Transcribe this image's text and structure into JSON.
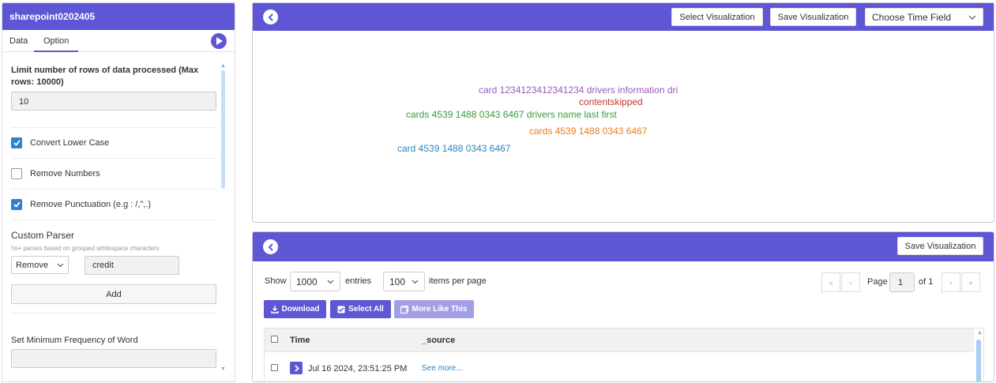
{
  "left": {
    "title": "sharepoint0202405",
    "tabs": [
      "Data",
      "Option"
    ],
    "active_tab": "Option",
    "limit_label": "Limit number of rows of data processed (Max rows: 10000)",
    "limit_value": "10",
    "checkboxes": [
      {
        "label": "Convert Lower Case",
        "checked": true
      },
      {
        "label": "Remove Numbers",
        "checked": false
      },
      {
        "label": "Remove Punctuation (e.g : /,\",.)",
        "checked": true
      }
    ],
    "custom_parser_label": "Custom Parser",
    "custom_parser_hint": "\\\\s+ parses based on grouped whitespace characters",
    "parser_mode": "Remove",
    "parser_value": "credit",
    "add_label": "Add",
    "min_freq_label": "Set Minimum Frequency of Word",
    "min_freq_value": ""
  },
  "viz": {
    "select_label": "Select Visualization",
    "save_label": "Save Visualization",
    "time_field_label": "Choose Time Field",
    "words": [
      {
        "text": "card 1234123412341234 drivers information dri",
        "color": "#9b59b6"
      },
      {
        "text": "contentskipped",
        "color": "#c0392b"
      },
      {
        "text": "cards 4539 1488 0343 6467 drivers name last first",
        "color": "#3a9a3a"
      },
      {
        "text": "cards 4539 1488 0343 6467",
        "color": "#e67e22"
      },
      {
        "text": "card 4539 1488 0343 6467",
        "color": "#2e86c1"
      }
    ]
  },
  "table": {
    "save_label": "Save Visualization",
    "show_label": "Show",
    "entries_value": "1000",
    "entries_label": "entries",
    "per_page_value": "100",
    "per_page_label": "items per page",
    "page_label": "Page",
    "page_value": "1",
    "of_label": "of 1",
    "download_label": "Download",
    "select_all_label": "Select All",
    "more_like_label": "More Like This",
    "columns": [
      "Time",
      "_source"
    ],
    "rows": [
      {
        "time": "Jul 16 2024, 23:51:25 PM",
        "source": "See more..."
      }
    ]
  },
  "colors": {
    "accent": "#5f56d6",
    "checkbox": "#2f80d1",
    "link": "#2e86c1"
  }
}
